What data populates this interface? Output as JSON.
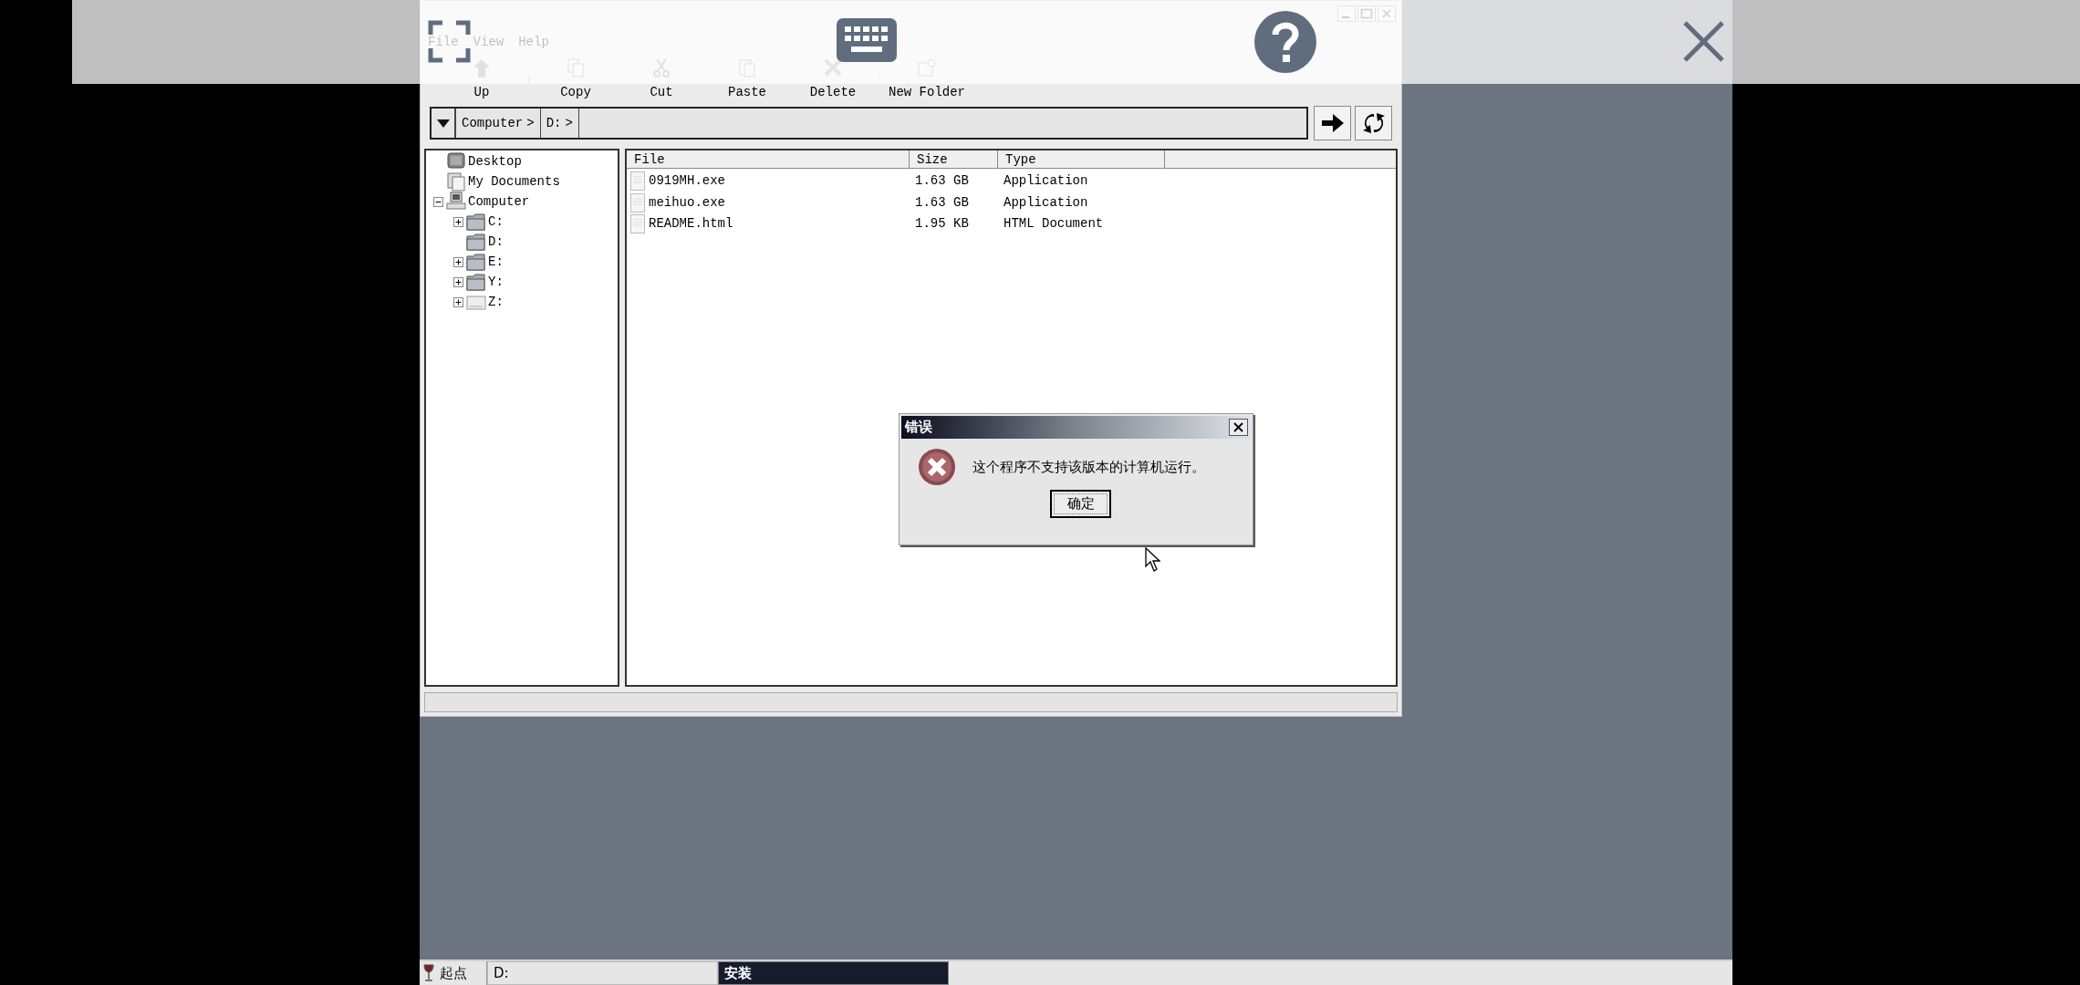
{
  "explorer": {
    "menu": [
      "File",
      "View",
      "Help"
    ],
    "toolbar": [
      {
        "kind": "up",
        "label": "Up",
        "separator_after": true
      },
      {
        "kind": "copy",
        "label": "Copy"
      },
      {
        "kind": "cut",
        "label": "Cut"
      },
      {
        "kind": "paste",
        "label": "Paste"
      },
      {
        "kind": "delete",
        "label": "Delete",
        "separator_after": true
      },
      {
        "kind": "new-folder",
        "label": "New Folder"
      }
    ],
    "address_bar": {
      "breadcrumbs": [
        "Computer",
        "D:"
      ],
      "separator": ">"
    },
    "tree": [
      {
        "label": "Desktop",
        "kind": "desktop"
      },
      {
        "label": "My Documents",
        "kind": "documents"
      },
      {
        "label": "Computer",
        "kind": "computer",
        "expanded": true,
        "children": [
          {
            "label": "C:",
            "kind": "folder",
            "expanded": false
          },
          {
            "label": "D:",
            "kind": "folder"
          },
          {
            "label": "E:",
            "kind": "folder",
            "expanded": false
          },
          {
            "label": "Y:",
            "kind": "folder",
            "expanded": false
          },
          {
            "label": "Z:",
            "kind": "drive",
            "expanded": false
          }
        ]
      }
    ],
    "file_list": {
      "columns": [
        "File",
        "Size",
        "Type"
      ],
      "rows": [
        {
          "name": "0919MH.exe",
          "size": "1.63 GB",
          "type": "Application"
        },
        {
          "name": "meihuo.exe",
          "size": "1.63 GB",
          "type": "Application"
        },
        {
          "name": "README.html",
          "size": "1.95 KB",
          "type": "HTML Document"
        }
      ]
    }
  },
  "dialog": {
    "title": "错误",
    "message": "这个程序不支持该版本的计算机运行。",
    "button": "确定"
  },
  "taskbar": {
    "start": "起点",
    "items": [
      {
        "label": "D:",
        "selected": false
      },
      {
        "label": "安装",
        "selected": true
      }
    ]
  }
}
